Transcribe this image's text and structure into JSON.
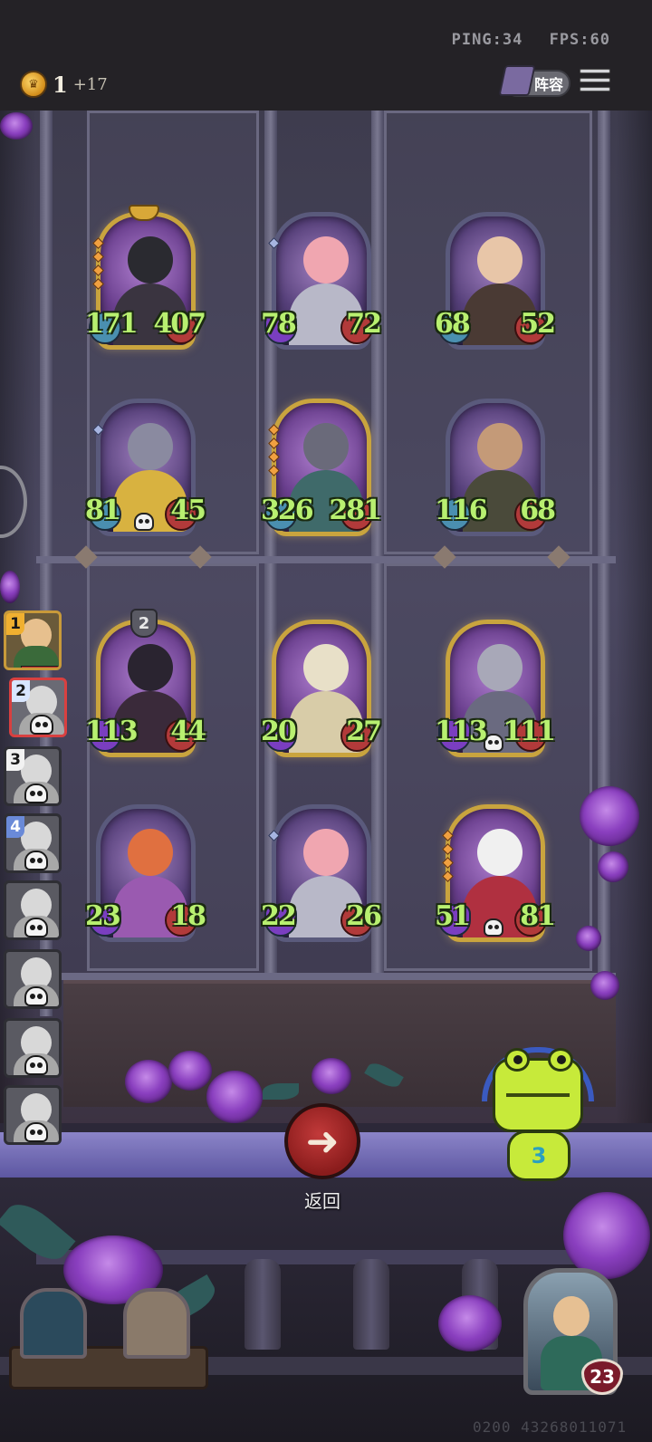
{
  "status": {
    "ping": "PING:34",
    "fps": "FPS:60"
  },
  "gold": {
    "value": "1",
    "increment": "+17"
  },
  "header": {
    "lineup_label": "阵容"
  },
  "board": {
    "rows": [
      [
        {
          "atk": "171",
          "hp": "407"
        },
        {
          "atk": "78",
          "hp": "72"
        },
        {
          "atk": "68",
          "hp": "52"
        }
      ],
      [
        {
          "atk": "81",
          "hp": "45"
        },
        {
          "atk": "326",
          "hp": "281"
        },
        {
          "atk": "116",
          "hp": "68"
        }
      ],
      [
        {
          "atk": "113",
          "hp": "44",
          "badge": "2"
        },
        {
          "atk": "20",
          "hp": "27"
        },
        {
          "atk": "113",
          "hp": "111"
        }
      ],
      [
        {
          "atk": "23",
          "hp": "18"
        },
        {
          "atk": "22",
          "hp": "26"
        },
        {
          "atk": "51",
          "hp": "81"
        }
      ]
    ]
  },
  "players": [
    {
      "rank": "1"
    },
    {
      "rank": "2"
    },
    {
      "rank": "3"
    },
    {
      "rank": "4"
    }
  ],
  "back": {
    "label": "返回",
    "icon": "left-arrow-icon"
  },
  "mascot": {
    "number": "3"
  },
  "hero": {
    "hp": "23"
  },
  "footer": {
    "build_id": "0200 43268011071"
  },
  "colors": {
    "stat_text": "#b8f070",
    "gold_frame": "#c9a43e",
    "back_button": "#b02a2a"
  }
}
